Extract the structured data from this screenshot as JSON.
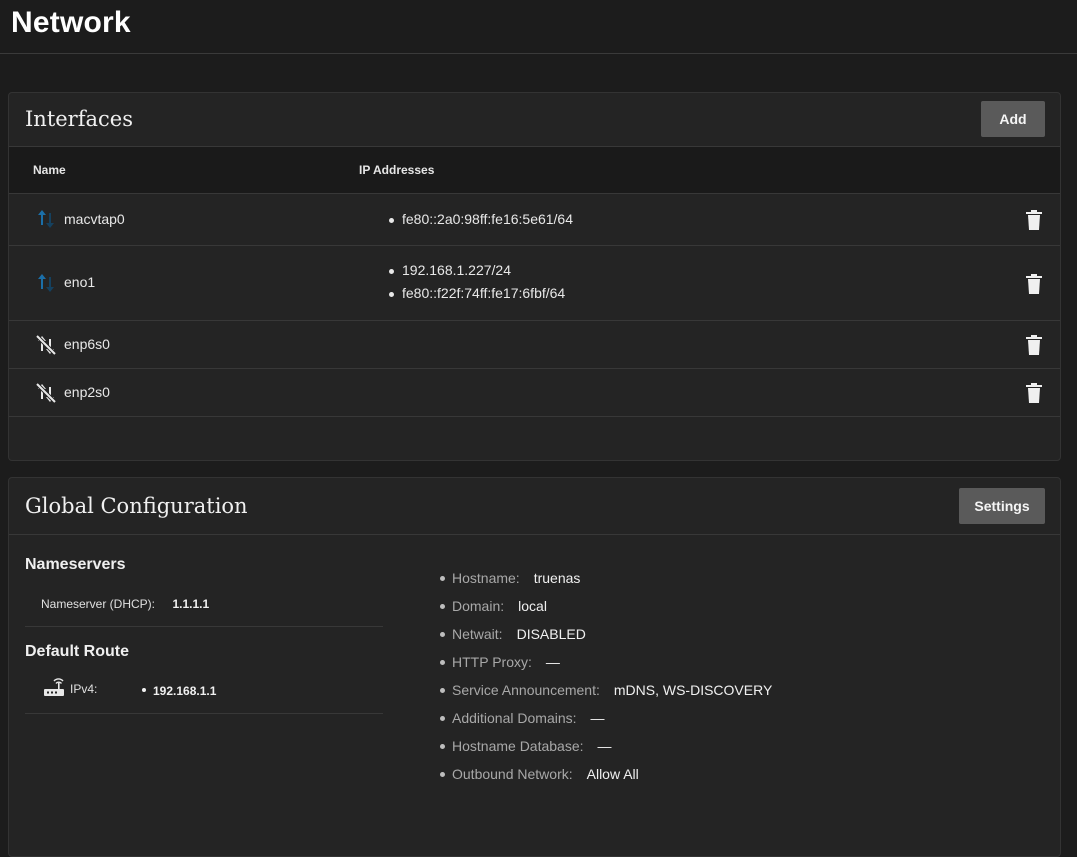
{
  "page": {
    "title": "Network"
  },
  "interfaces": {
    "title": "Interfaces",
    "add_label": "Add",
    "columns": {
      "name": "Name",
      "ip": "IP Addresses"
    },
    "rows": [
      {
        "name": "macvtap0",
        "status": "up",
        "ips": [
          "fe80::2a0:98ff:fe16:5e61/64"
        ]
      },
      {
        "name": "eno1",
        "status": "up",
        "ips": [
          "192.168.1.227/24",
          "fe80::f22f:74ff:fe17:6fbf/64"
        ]
      },
      {
        "name": "enp6s0",
        "status": "down",
        "ips": []
      },
      {
        "name": "enp2s0",
        "status": "down",
        "ips": []
      }
    ]
  },
  "global": {
    "title": "Global Configuration",
    "settings_label": "Settings",
    "nameservers": {
      "title": "Nameservers",
      "label": "Nameserver (DHCP):",
      "value": "1.1.1.1"
    },
    "default_route": {
      "title": "Default Route",
      "label": "IPv4:",
      "value": "192.168.1.1"
    },
    "config": [
      {
        "label": "Hostname:",
        "value": "truenas"
      },
      {
        "label": "Domain:",
        "value": "local"
      },
      {
        "label": "Netwait:",
        "value": "DISABLED"
      },
      {
        "label": "HTTP Proxy:",
        "value": "—"
      },
      {
        "label": "Service Announcement:",
        "value": "mDNS, WS-DISCOVERY"
      },
      {
        "label": "Additional Domains:",
        "value": "—"
      },
      {
        "label": "Hostname Database:",
        "value": "—"
      },
      {
        "label": "Outbound Network:",
        "value": "Allow All"
      }
    ]
  },
  "icons": {
    "up": "arrows-up-down-icon",
    "down": "link-off-icon",
    "trash": "trash-icon",
    "router": "router-icon"
  },
  "colors": {
    "up_arrow": "#1b6fa8",
    "up_arrow_dark": "#15415f"
  }
}
